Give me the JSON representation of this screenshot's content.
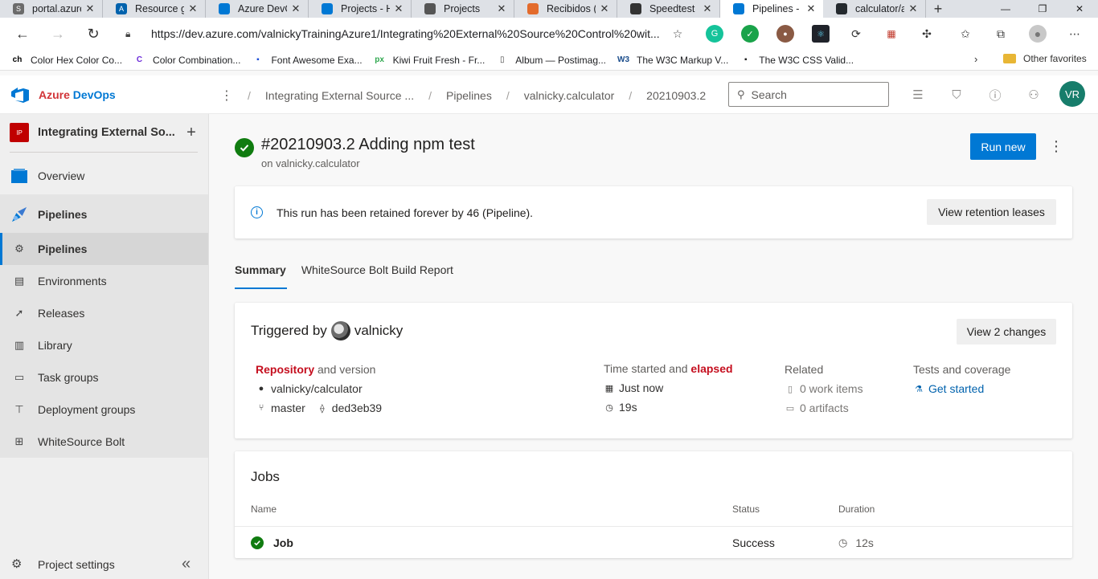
{
  "browser": {
    "tabs": [
      {
        "label": "portal.azure",
        "fav": "S",
        "favcolor": "#6b6b6b",
        "active": false
      },
      {
        "label": "Resource gr",
        "fav": "A",
        "favcolor": "#0062ad",
        "active": false
      },
      {
        "label": "Azure DevO",
        "fav": "",
        "favcolor": "#0078d4",
        "active": false
      },
      {
        "label": "Projects - H",
        "fav": "",
        "favcolor": "#0078d4",
        "active": false
      },
      {
        "label": "Projects",
        "fav": "",
        "favcolor": "#555555",
        "active": false
      },
      {
        "label": "Recibidos (",
        "fav": "",
        "favcolor": "#e36b2c",
        "active": false
      },
      {
        "label": "Speedtest",
        "fav": "",
        "favcolor": "#333333",
        "active": false
      },
      {
        "label": "Pipelines -",
        "fav": "",
        "favcolor": "#0078d4",
        "active": true
      },
      {
        "label": "calculator/a",
        "fav": "",
        "favcolor": "#24292e",
        "active": false
      }
    ],
    "close_glyph": "✕",
    "new_tab_glyph": "+",
    "url": "https://dev.azure.com/valnickyTrainingAzure1/Integrating%20External%20Source%20Control%20wit...",
    "bookmarks": [
      {
        "label": "Color Hex Color Co...",
        "icon": "ch",
        "color": "#000000"
      },
      {
        "label": "Color Combination...",
        "icon": "C",
        "color": "#6c2bd9"
      },
      {
        "label": "Font Awesome Exa...",
        "icon": "▪",
        "color": "#1e4fd8"
      },
      {
        "label": "Kiwi Fruit Fresh - Fr...",
        "icon": "px",
        "color": "#2fa84f"
      },
      {
        "label": "Album — Postimag...",
        "icon": "▯",
        "color": "#444444"
      },
      {
        "label": "The W3C Markup V...",
        "icon": "W3",
        "color": "#1a4c8b"
      },
      {
        "label": "The W3C CSS Valid...",
        "icon": "▪",
        "color": "#222222"
      }
    ],
    "other_favorites": "Other favorites"
  },
  "header": {
    "brand_part1": "Azure",
    "brand_part2": "DevOps",
    "breadcrumbs": [
      "Integrating External Source ...",
      "Pipelines",
      "valnicky.calculator",
      "20210903.2"
    ],
    "search_placeholder": "Search",
    "avatar_initials": "VR"
  },
  "sidebar": {
    "project_badge": "IP",
    "project_name": "Integrating External So...",
    "overview": "Overview",
    "pipelines_group": "Pipelines",
    "items": [
      "Pipelines",
      "Environments",
      "Releases",
      "Library",
      "Task groups",
      "Deployment groups",
      "WhiteSource Bolt"
    ],
    "settings": "Project settings"
  },
  "run": {
    "title": "#20210903.2 Adding npm test",
    "subtitle": "on valnicky.calculator",
    "run_new": "Run new",
    "retention_text": "This run has been retained forever by 46 (Pipeline).",
    "retention_button": "View retention leases"
  },
  "tabs": [
    "Summary",
    "WhiteSource Bolt Build Report"
  ],
  "summary": {
    "triggered_by": "Triggered by",
    "user": "valnicky",
    "view_changes": "View 2 changes",
    "repo_label_bold": "Repository",
    "repo_label_rest": " and version",
    "repo": "valnicky/calculator",
    "branch": "master",
    "commit": "ded3eb39",
    "time_label": "Time started and ",
    "time_label_bold": "elapsed",
    "started": "Just now",
    "elapsed": "19s",
    "related_label": "Related",
    "work_items": "0 work items",
    "artifacts": "0 artifacts",
    "tests_label": "Tests and coverage",
    "get_started": "Get started"
  },
  "jobs": {
    "title": "Jobs",
    "columns": [
      "Name",
      "Status",
      "Duration"
    ],
    "rows": [
      {
        "name": "Job",
        "status": "Success",
        "duration": "12s"
      }
    ]
  }
}
